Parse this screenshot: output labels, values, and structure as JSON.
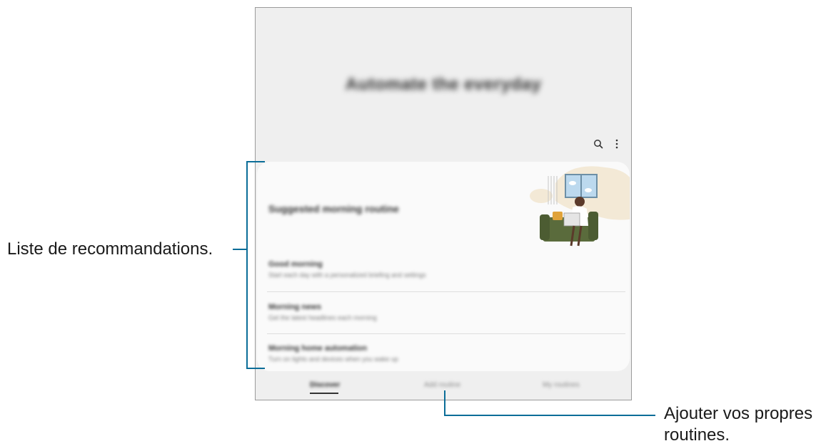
{
  "screen": {
    "hero_title": "Automate the everyday",
    "toolbar": {
      "search_icon": "search-icon",
      "more_icon": "more-options-icon"
    },
    "card": {
      "heading": "Suggested morning routine",
      "items": [
        {
          "title": "Good morning",
          "desc": "Start each day with a personalized briefing and settings"
        },
        {
          "title": "Morning news",
          "desc": "Get the latest headlines each morning"
        },
        {
          "title": "Morning home automation",
          "desc": "Turn on lights and devices when you wake up"
        }
      ]
    },
    "tabs": [
      {
        "label": "Discover",
        "active": true
      },
      {
        "label": "Add routine",
        "active": false
      },
      {
        "label": "My routines",
        "active": false
      }
    ]
  },
  "callouts": {
    "recommendations": "Liste de recommandations.",
    "add_routines_line1": "Ajouter vos propres",
    "add_routines_line2": "routines."
  },
  "colors": {
    "callout_line": "#0b6d98",
    "screen_bg": "#efefef",
    "card_bg": "#fafafa"
  }
}
